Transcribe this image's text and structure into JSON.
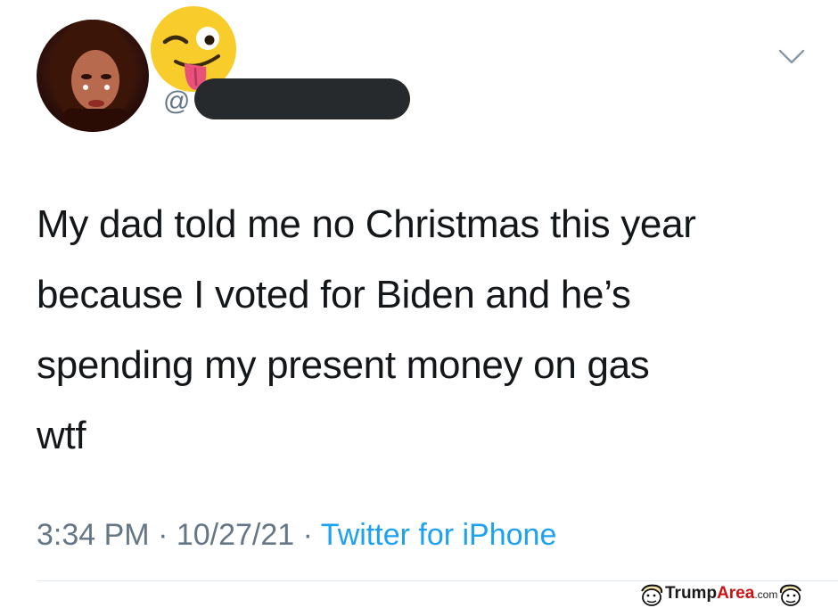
{
  "tweet": {
    "handle_prefix": "@",
    "text_lines": [
      "My dad told me no Christmas this year",
      "because I voted for Biden and he’s",
      "spending my present money on gas",
      "wtf"
    ],
    "timestamp": "3:34 PM · 10/27/21 · ",
    "source": "Twitter for iPhone"
  },
  "watermark": {
    "part1": "Trump",
    "part2": "Area",
    "part3": ".com"
  },
  "icons": {
    "avatar": "profile-photo",
    "emoji": "winking-face-with-tongue",
    "menu": "chevron-down-icon",
    "mascot": "cartoon-face-icon"
  },
  "colors": {
    "text": "#14171a",
    "secondary": "#657786",
    "link": "#1da1f2",
    "divider": "#e1e8ed",
    "redaction": "#272a2d"
  }
}
